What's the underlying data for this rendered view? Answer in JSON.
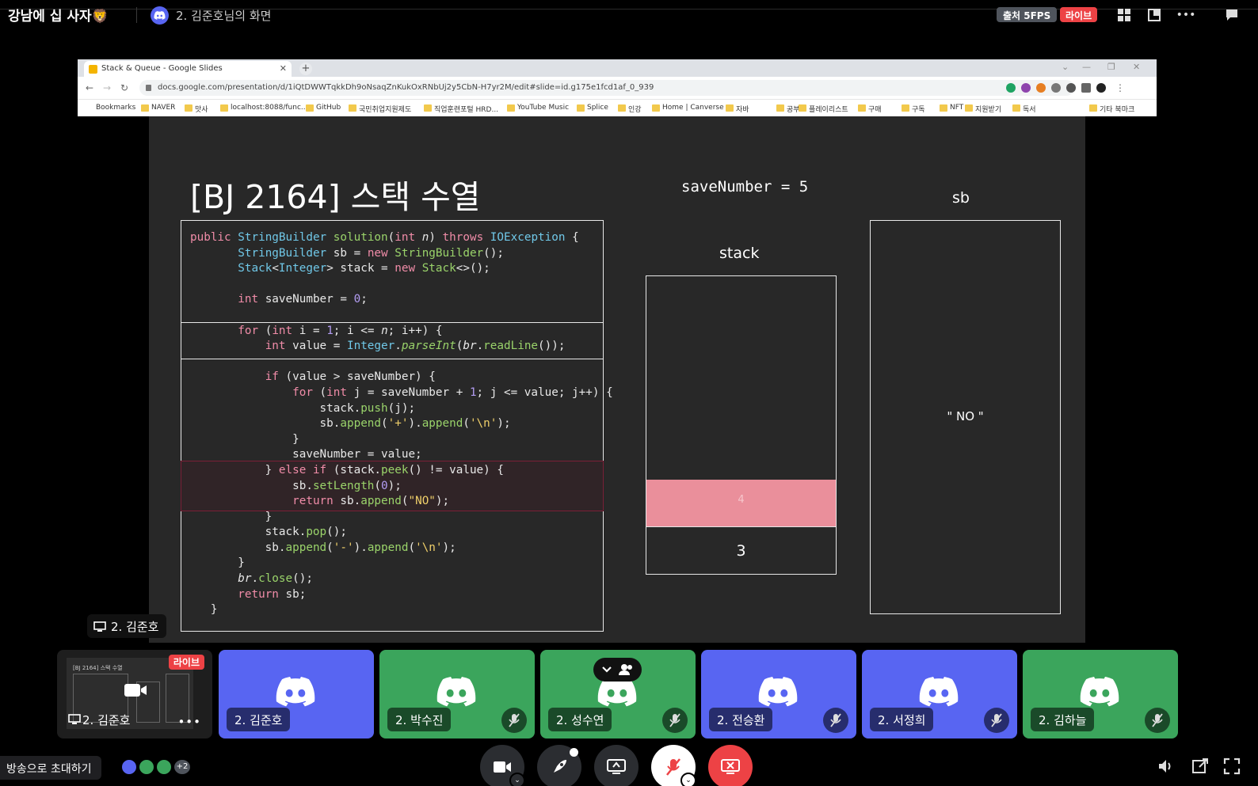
{
  "topbar": {
    "server_title": "강남에 십 사자🦁",
    "screen_title": "2. 김준호님의 화면",
    "fps_label": "출처 5FPS",
    "live_label": "라이브"
  },
  "browser": {
    "tab_title": "Stack & Queue - Google Slides",
    "url": "docs.google.com/presentation/d/1iQtDWWTqkkDh9oNsaqZnKukOxRNbUj2y5CbN-H7yr2M/edit#slide=id.g175e1fcd1af_0_939",
    "bookmarks": [
      "Bookmarks",
      "NAVER",
      "맛사",
      "localhost:8088/func...",
      "GitHub",
      "국민취업지원제도",
      "직업훈련포털 HRD...",
      "YouTube Music",
      "Splice",
      "인강",
      "Home | Canverse",
      "자바",
      "공부",
      "플레이리스트",
      "구매",
      "구독",
      "NFT",
      "지원받기",
      "독서",
      "기타 북마크"
    ]
  },
  "slide": {
    "title": "[BJ 2164] 스택 수열",
    "save_number_label": "saveNumber = 5",
    "stack_label": "stack",
    "stack_top_value": "4",
    "stack_bottom_value": "3",
    "sb_label": "sb",
    "sb_value": "\" NO \""
  },
  "sharer_tag": "2. 김준호",
  "participants": [
    {
      "name": "2. 김준호",
      "color": "blue",
      "muted": false
    },
    {
      "name": "2. 박수진",
      "color": "green",
      "muted": true
    },
    {
      "name": "2. 성수연",
      "color": "green",
      "muted": true
    },
    {
      "name": "2. 전승환",
      "color": "blue",
      "muted": true
    },
    {
      "name": "2. 서정희",
      "color": "blue",
      "muted": true
    },
    {
      "name": "2. 김하늘",
      "color": "green",
      "muted": true
    }
  ],
  "screen_tile": {
    "name": "2. 김준호",
    "live_label": "라이브",
    "more": "•••"
  },
  "bottom": {
    "invite_label": "방송으로 초대하기",
    "avatar_extra": "+2"
  },
  "colors": {
    "blurple": "#5865f2",
    "green": "#3ba55c",
    "red": "#ed4245",
    "stack_highlight": "#ea8f9b"
  }
}
